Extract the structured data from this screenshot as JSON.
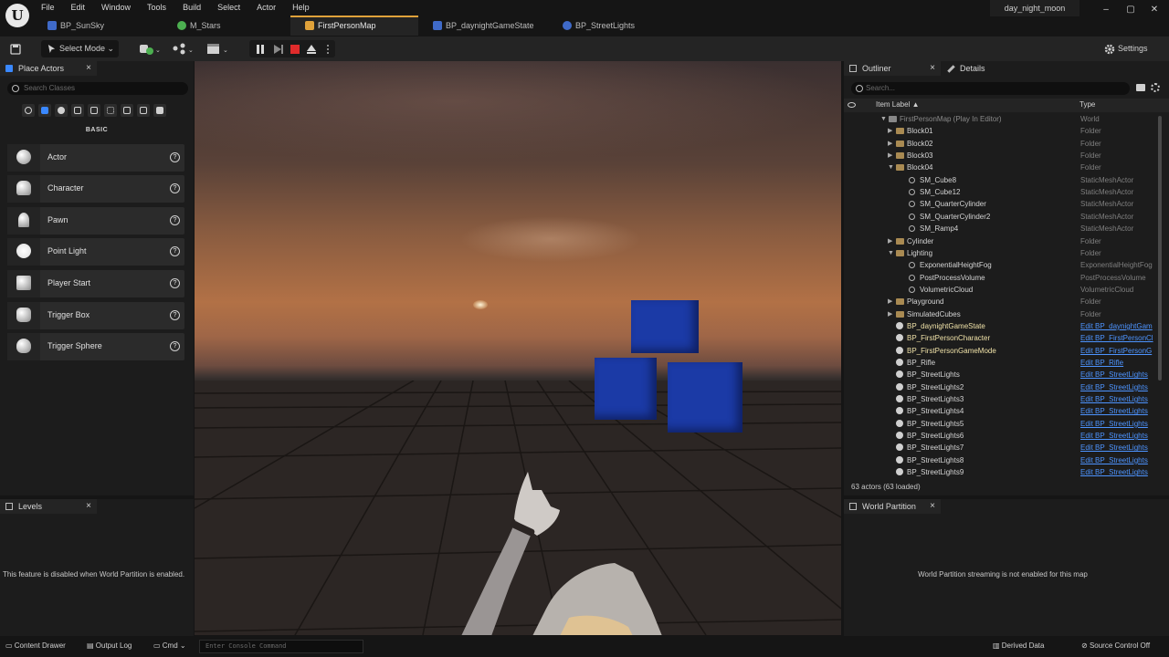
{
  "app": {
    "project_name": "day_night_moon",
    "menu": [
      "File",
      "Edit",
      "Window",
      "Tools",
      "Build",
      "Select",
      "Actor",
      "Help"
    ],
    "window_controls": {
      "minimize": "–",
      "maximize": "▢",
      "close": "✕"
    }
  },
  "tabs": [
    {
      "label": "BP_SunSky",
      "icon_color": "#3f6ac8",
      "active": false
    },
    {
      "label": "M_Stars",
      "icon_color": "#4caf50",
      "active": false
    },
    {
      "label": "FirstPersonMap",
      "icon_color": "#e0a23a",
      "active": true
    },
    {
      "label": "BP_daynightGameState",
      "icon_color": "#3f6ac8",
      "active": false
    },
    {
      "label": "BP_StreetLights",
      "icon_color": "#3f6ac8",
      "active": false
    }
  ],
  "toolbar": {
    "select_mode": "Select Mode",
    "settings": "Settings"
  },
  "place_actors": {
    "tab_label": "Place Actors",
    "search_placeholder": "Search Classes",
    "section": "BASIC",
    "items": [
      "Actor",
      "Character",
      "Pawn",
      "Point Light",
      "Player Start",
      "Trigger Box",
      "Trigger Sphere"
    ]
  },
  "levels": {
    "tab_label": "Levels",
    "message": "This feature is disabled when World Partition is enabled."
  },
  "outliner": {
    "tab_label": "Outliner",
    "details_tab_label": "Details",
    "search_placeholder": "Search...",
    "col_label": "Item Label ▲",
    "col_type": "Type",
    "rows": [
      {
        "label": "FirstPersonMap (Play In Editor)",
        "type": "World",
        "indent": 0,
        "arrow": "▼",
        "icon": "world",
        "dim": true
      },
      {
        "label": "Block01",
        "type": "Folder",
        "indent": 1,
        "arrow": "▶",
        "icon": "folder"
      },
      {
        "label": "Block02",
        "type": "Folder",
        "indent": 1,
        "arrow": "▶",
        "icon": "folder"
      },
      {
        "label": "Block03",
        "type": "Folder",
        "indent": 1,
        "arrow": "▶",
        "icon": "folder"
      },
      {
        "label": "Block04",
        "type": "Folder",
        "indent": 1,
        "arrow": "▼",
        "icon": "folder"
      },
      {
        "label": "SM_Cube8",
        "type": "StaticMeshActor",
        "indent": 2,
        "arrow": "",
        "icon": "mesh"
      },
      {
        "label": "SM_Cube12",
        "type": "StaticMeshActor",
        "indent": 2,
        "arrow": "",
        "icon": "mesh"
      },
      {
        "label": "SM_QuarterCylinder",
        "type": "StaticMeshActor",
        "indent": 2,
        "arrow": "",
        "icon": "mesh"
      },
      {
        "label": "SM_QuarterCylinder2",
        "type": "StaticMeshActor",
        "indent": 2,
        "arrow": "",
        "icon": "mesh"
      },
      {
        "label": "SM_Ramp4",
        "type": "StaticMeshActor",
        "indent": 2,
        "arrow": "",
        "icon": "mesh"
      },
      {
        "label": "Cylinder",
        "type": "Folder",
        "indent": 1,
        "arrow": "▶",
        "icon": "folder"
      },
      {
        "label": "Lighting",
        "type": "Folder",
        "indent": 1,
        "arrow": "▼",
        "icon": "folder"
      },
      {
        "label": "ExponentialHeightFog",
        "type": "ExponentialHeightFog",
        "indent": 2,
        "arrow": "",
        "icon": "mesh"
      },
      {
        "label": "PostProcessVolume",
        "type": "PostProcessVolume",
        "indent": 2,
        "arrow": "",
        "icon": "mesh"
      },
      {
        "label": "VolumetricCloud",
        "type": "VolumetricCloud",
        "indent": 2,
        "arrow": "",
        "icon": "mesh"
      },
      {
        "label": "Playground",
        "type": "Folder",
        "indent": 1,
        "arrow": "▶",
        "icon": "folder"
      },
      {
        "label": "SimulatedCubes",
        "type": "Folder",
        "indent": 1,
        "arrow": "▶",
        "icon": "folder"
      },
      {
        "label": "BP_daynightGameState",
        "type": "Edit BP_daynightGam",
        "indent": 1,
        "arrow": "",
        "icon": "bp",
        "link": true,
        "highlight": true
      },
      {
        "label": "BP_FirstPersonCharacter",
        "type": "Edit BP_FirstPersonCl",
        "indent": 1,
        "arrow": "",
        "icon": "bp",
        "link": true,
        "highlight": true
      },
      {
        "label": "BP_FirstPersonGameMode",
        "type": "Edit BP_FirstPersonG",
        "indent": 1,
        "arrow": "",
        "icon": "bp",
        "link": true,
        "highlight": true
      },
      {
        "label": "BP_Rifle",
        "type": "Edit BP_Rifle",
        "indent": 1,
        "arrow": "",
        "icon": "bp",
        "link": true
      },
      {
        "label": "BP_StreetLights",
        "type": "Edit BP_StreetLights",
        "indent": 1,
        "arrow": "",
        "icon": "bp",
        "link": true
      },
      {
        "label": "BP_StreetLights2",
        "type": "Edit BP_StreetLights",
        "indent": 1,
        "arrow": "",
        "icon": "bp",
        "link": true
      },
      {
        "label": "BP_StreetLights3",
        "type": "Edit BP_StreetLights",
        "indent": 1,
        "arrow": "",
        "icon": "bp",
        "link": true
      },
      {
        "label": "BP_StreetLights4",
        "type": "Edit BP_StreetLights",
        "indent": 1,
        "arrow": "",
        "icon": "bp",
        "link": true
      },
      {
        "label": "BP_StreetLights5",
        "type": "Edit BP_StreetLights",
        "indent": 1,
        "arrow": "",
        "icon": "bp",
        "link": true
      },
      {
        "label": "BP_StreetLights6",
        "type": "Edit BP_StreetLights",
        "indent": 1,
        "arrow": "",
        "icon": "bp",
        "link": true
      },
      {
        "label": "BP_StreetLights7",
        "type": "Edit BP_StreetLights",
        "indent": 1,
        "arrow": "",
        "icon": "bp",
        "link": true
      },
      {
        "label": "BP_StreetLights8",
        "type": "Edit BP_StreetLights",
        "indent": 1,
        "arrow": "",
        "icon": "bp",
        "link": true
      },
      {
        "label": "BP_StreetLights9",
        "type": "Edit BP_StreetLights",
        "indent": 1,
        "arrow": "",
        "icon": "bp",
        "link": true
      }
    ],
    "count": "63 actors (63 loaded)"
  },
  "world_partition": {
    "tab_label": "World Partition",
    "message": "World Partition streaming is not enabled for this map"
  },
  "statusbar": {
    "content_drawer": "Content Drawer",
    "output_log": "Output Log",
    "cmd": "Cmd",
    "console_placeholder": "Enter Console Command",
    "derived_data": "Derived Data",
    "source_control": "Source Control Off"
  },
  "colors": {
    "accent": "#e0a23a",
    "link": "#4d94ff",
    "cube": "#1b3aa6",
    "stop": "#e02b2b"
  }
}
